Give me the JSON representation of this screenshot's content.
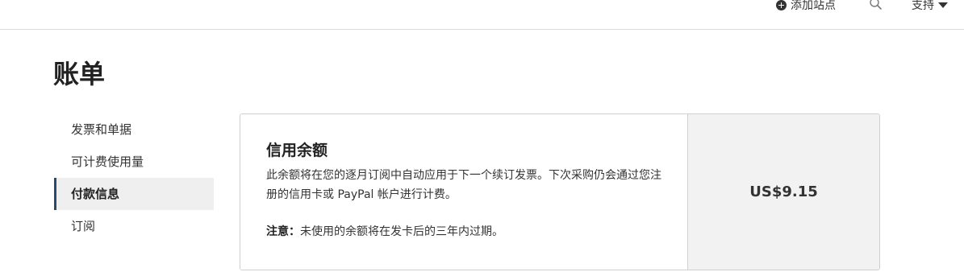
{
  "topbar": {
    "add_site_label": "添加站点",
    "add_site_icon": "plus-circle-icon",
    "search_icon": "search-icon",
    "support_label": "支持",
    "support_icon": "caret-down-icon"
  },
  "page": {
    "title": "账单"
  },
  "sidebar": {
    "items": [
      {
        "label": "发票和单据",
        "active": false
      },
      {
        "label": "可计费使用量",
        "active": false
      },
      {
        "label": "付款信息",
        "active": true
      },
      {
        "label": "订阅",
        "active": false
      }
    ]
  },
  "credit": {
    "title": "信用余额",
    "description": "此余额将在您的逐月订阅中自动应用于下一个续订发票。下次采购仍会通过您注册的信用卡或 PayPal 帐户进行计费。",
    "note_label": "注意：",
    "note_text": "未使用的余额将在发卡后的三年内过期。",
    "amount": "US$9.15"
  },
  "colors": {
    "active_indicator": "#2a4a6a",
    "active_bg": "#efefef",
    "amount_panel_bg": "#f2f2f2",
    "border": "#cfcfcf"
  }
}
